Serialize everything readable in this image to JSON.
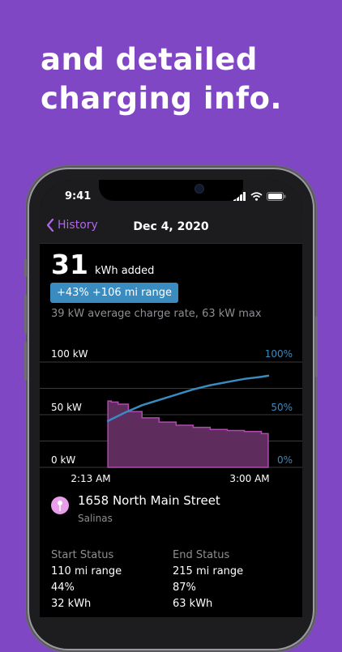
{
  "promo": {
    "headline_line1": "and detailed",
    "headline_line2": "charging info."
  },
  "status_bar": {
    "time": "9:41"
  },
  "nav": {
    "back_label": "History",
    "title": "Dec 4, 2020"
  },
  "summary": {
    "kwh_value": "31",
    "kwh_label": "kWh added",
    "badge": "+43%  +106 mi range",
    "rate": "39 kW average charge rate, 63 kW max"
  },
  "colors": {
    "accent": "#b067e8",
    "badge": "#3a8bc0",
    "soc_line": "#3a8bc0",
    "power_fill": "#5e2d5e",
    "power_line": "#b04ab0",
    "background": "#8047c4"
  },
  "chart_data": {
    "type": "area",
    "y_left_ticks": [
      "100 kW",
      "50  kW",
      "0 kW"
    ],
    "y_right_ticks": [
      "100%",
      "50%",
      "0%"
    ],
    "x_tick_labels": [
      "2:13 AM",
      "3:00 AM"
    ],
    "ylim_power": [
      0,
      100
    ],
    "ylim_soc": [
      0,
      100
    ],
    "xlim_minutes": [
      -20,
      57
    ],
    "series": [
      {
        "unit": "kW",
        "x_minutes": [
          0,
          1,
          3,
          6,
          10,
          15,
          20,
          25,
          30,
          35,
          40,
          45,
          47
        ],
        "values": [
          63,
          62,
          60,
          53,
          47,
          43,
          40,
          38,
          36,
          35,
          34,
          32,
          31
        ]
      },
      {
        "unit": "%",
        "x_minutes": [
          0,
          5,
          10,
          15,
          20,
          25,
          30,
          35,
          40,
          45,
          47
        ],
        "values": [
          44,
          52,
          59,
          64,
          69,
          74,
          78,
          81,
          84,
          86,
          87
        ]
      }
    ]
  },
  "location": {
    "address": "1658 North Main Street",
    "city": "Salinas"
  },
  "start_status": {
    "header": "Start Status",
    "range": "110 mi range",
    "percent": "44%",
    "energy": "32 kWh"
  },
  "end_status": {
    "header": "End Status",
    "range": "215 mi range",
    "percent": "87%",
    "energy": "63 kWh"
  }
}
